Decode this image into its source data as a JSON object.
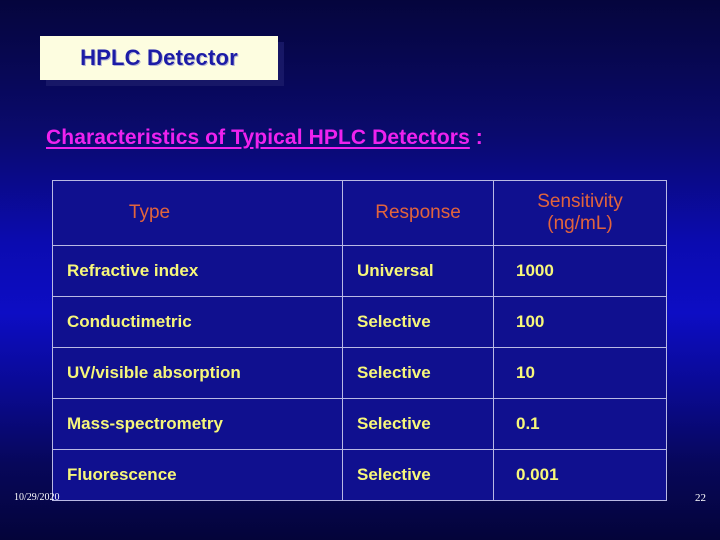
{
  "slide": {
    "title": "HPLC Detector",
    "heading_underlined": "Characteristics of Typical HPLC Detectors",
    "heading_suffix": " :",
    "colors": {
      "background_top": "#05053d",
      "background_mid": "#0d0dc4",
      "title_box_fill": "#fdfde0",
      "title_text": "#1c1ca6",
      "heading_text": "#ee22ee",
      "table_fill": "#10108f",
      "table_border": "#b9b9e4",
      "table_header_text": "#e2643c",
      "table_body_text": "#f7f77a",
      "footer_text": "#ffffff"
    }
  },
  "table": {
    "headers": [
      "Type",
      "Response",
      "Sensitivity (ng/mL)"
    ],
    "header_sensitivity_line1": "Sensitivity",
    "header_sensitivity_line2": "(ng/mL)",
    "rows": [
      {
        "type": "Refractive index",
        "response": "Universal",
        "sensitivity": "1000"
      },
      {
        "type": "Conductimetric",
        "response": "Selective",
        "sensitivity": "100"
      },
      {
        "type": "UV/visible absorption",
        "response": "Selective",
        "sensitivity": "10"
      },
      {
        "type": "Mass-spectrometry",
        "response": "Selective",
        "sensitivity": "0.1"
      },
      {
        "type": "Fluorescence",
        "response": "Selective",
        "sensitivity": "0.001"
      }
    ]
  },
  "footer": {
    "date": "10/29/2020",
    "page_number": "22"
  }
}
